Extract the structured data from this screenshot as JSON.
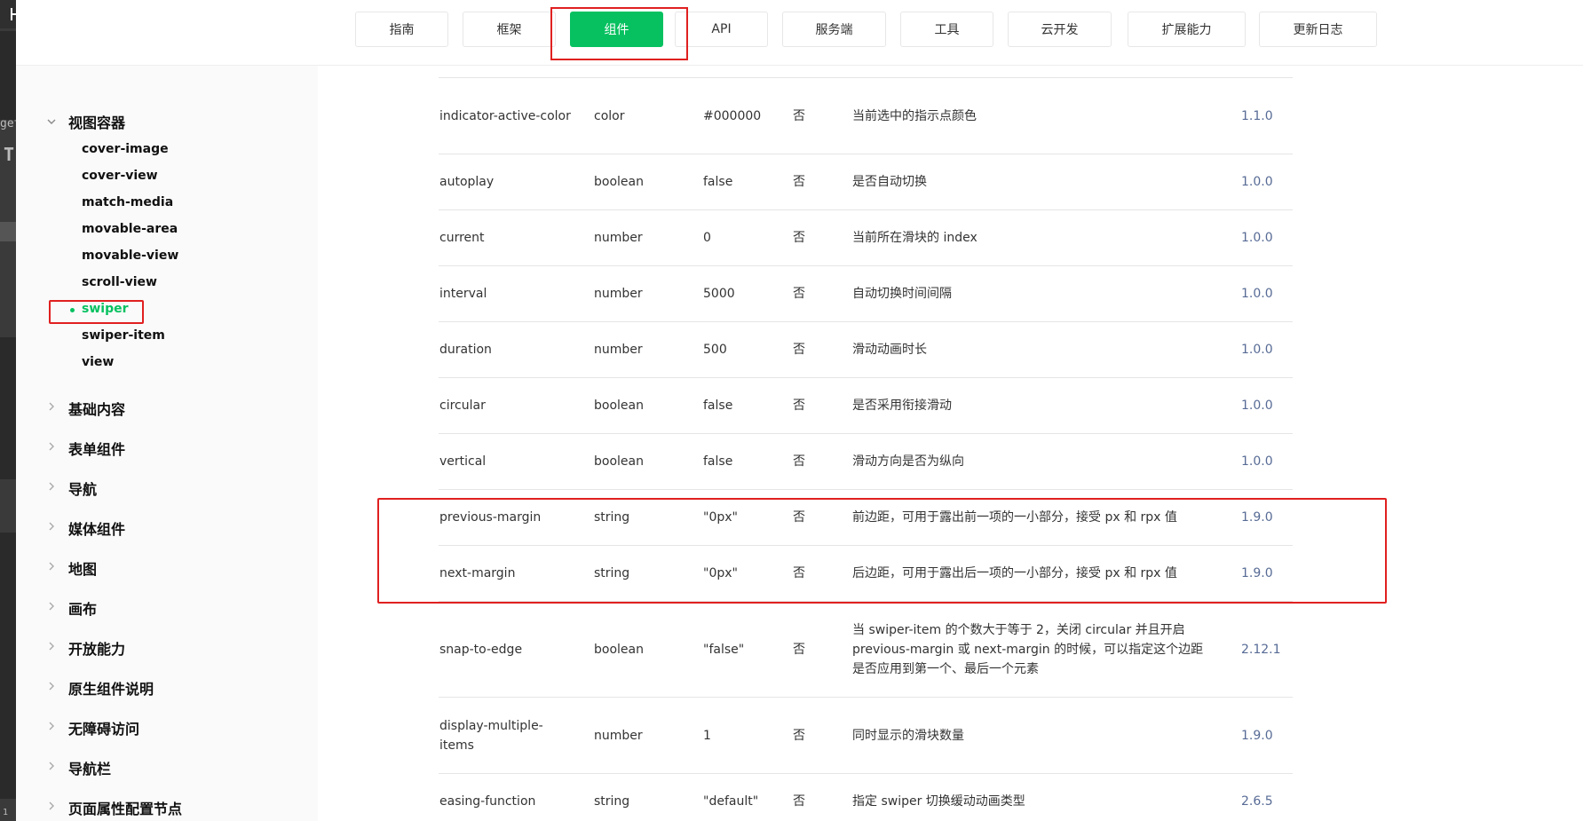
{
  "left_strip": {
    "texts": [
      "get",
      "T",
      "1"
    ]
  },
  "topnav": {
    "tabs": [
      {
        "label": "指南"
      },
      {
        "label": "框架"
      },
      {
        "label": "组件",
        "active": true
      },
      {
        "label": "API"
      },
      {
        "label": "服务端"
      },
      {
        "label": "工具"
      },
      {
        "label": "云开发"
      },
      {
        "label": "扩展能力"
      },
      {
        "label": "更新日志"
      }
    ]
  },
  "sidebar": {
    "open_category": "视图容器",
    "items": [
      "cover-image",
      "cover-view",
      "match-media",
      "movable-area",
      "movable-view",
      "scroll-view",
      "swiper",
      "swiper-item",
      "view"
    ],
    "active_item": "swiper",
    "categories": [
      "基础内容",
      "表单组件",
      "导航",
      "媒体组件",
      "地图",
      "画布",
      "开放能力",
      "原生组件说明",
      "无障碍访问",
      "导航栏",
      "页面属性配置节点"
    ]
  },
  "table": {
    "rows": [
      {
        "name": "indicator-active-color",
        "type": "color",
        "default": "#000000",
        "required": "否",
        "desc": "当前选中的指示点颜色",
        "version": "1.1.0"
      },
      {
        "name": "autoplay",
        "type": "boolean",
        "default": "false",
        "required": "否",
        "desc": "是否自动切换",
        "version": "1.0.0"
      },
      {
        "name": "current",
        "type": "number",
        "default": "0",
        "required": "否",
        "desc": "当前所在滑块的 index",
        "version": "1.0.0"
      },
      {
        "name": "interval",
        "type": "number",
        "default": "5000",
        "required": "否",
        "desc": "自动切换时间间隔",
        "version": "1.0.0"
      },
      {
        "name": "duration",
        "type": "number",
        "default": "500",
        "required": "否",
        "desc": "滑动动画时长",
        "version": "1.0.0"
      },
      {
        "name": "circular",
        "type": "boolean",
        "default": "false",
        "required": "否",
        "desc": "是否采用衔接滑动",
        "version": "1.0.0"
      },
      {
        "name": "vertical",
        "type": "boolean",
        "default": "false",
        "required": "否",
        "desc": "滑动方向是否为纵向",
        "version": "1.0.0"
      },
      {
        "name": "previous-margin",
        "type": "string",
        "default": "\"0px\"",
        "required": "否",
        "desc": "前边距，可用于露出前一项的一小部分，接受 px 和 rpx 值",
        "version": "1.9.0"
      },
      {
        "name": "next-margin",
        "type": "string",
        "default": "\"0px\"",
        "required": "否",
        "desc": "后边距，可用于露出后一项的一小部分，接受 px 和 rpx 值",
        "version": "1.9.0"
      },
      {
        "name": "snap-to-edge",
        "type": "boolean",
        "default": "\"false\"",
        "required": "否",
        "desc": "当 swiper-item 的个数大于等于 2，关闭 circular 并且开启 previous-margin 或 next-margin 的时候，可以指定这个边距是否应用到第一个、最后一个元素",
        "version": "2.12.1"
      },
      {
        "name": "display-multiple-items",
        "type": "number",
        "default": "1",
        "required": "否",
        "desc": "同时显示的滑块数量",
        "version": "1.9.0"
      },
      {
        "name": "easing-function",
        "type": "string",
        "default": "\"default\"",
        "required": "否",
        "desc": "指定 swiper 切换缓动动画类型",
        "version": "2.6.5"
      }
    ]
  },
  "colors": {
    "accent": "#07c160",
    "highlight": "#e02020",
    "version_link": "#576b95"
  }
}
